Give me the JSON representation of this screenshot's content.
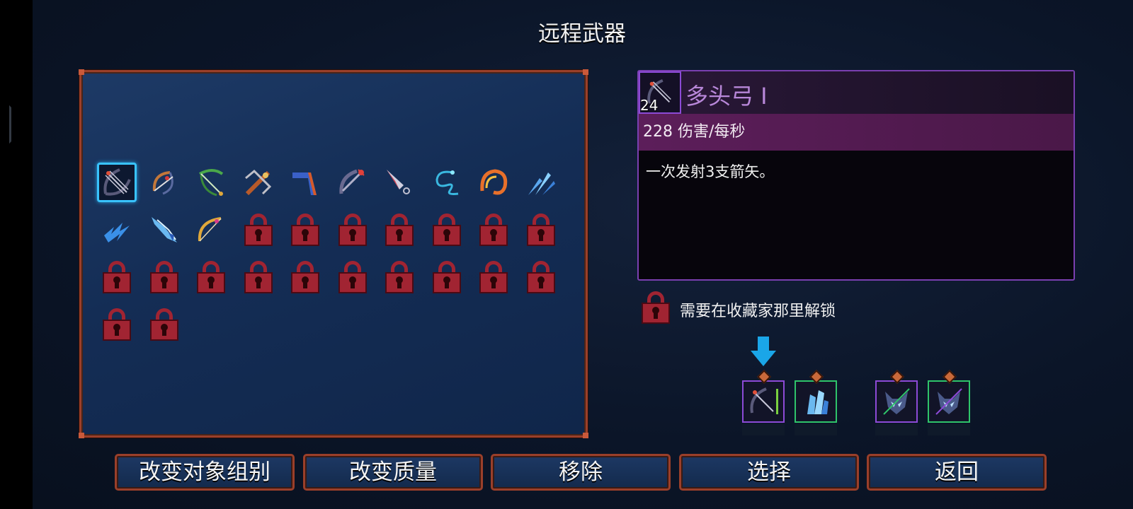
{
  "page": {
    "title": "远程武器"
  },
  "grid": {
    "weapons": [
      {
        "name": "multiple-nocks-bow-icon",
        "selected": true
      },
      {
        "name": "bow-icon"
      },
      {
        "name": "green-bow-icon"
      },
      {
        "name": "crossbow-icon"
      },
      {
        "name": "boomerang-icon"
      },
      {
        "name": "heavy-crossbow-icon"
      },
      {
        "name": "throwing-knife-icon"
      },
      {
        "name": "electric-whip-icon"
      },
      {
        "name": "fire-blast-icon"
      },
      {
        "name": "ice-shards-icon"
      },
      {
        "name": "lightning-icon"
      },
      {
        "name": "ice-crystal-icon"
      },
      {
        "name": "golden-bow-icon"
      }
    ],
    "locked_count": 19
  },
  "info": {
    "level": "24",
    "name": "多头弓 I",
    "stat": "228 伤害/每秒",
    "description": "一次发射3支箭矢。",
    "rarity_color": "#8c4ad6"
  },
  "unlock": {
    "text": "需要在收藏家那里解锁"
  },
  "equipment": [
    {
      "name": "equipped-bow-icon",
      "border": "purple"
    },
    {
      "name": "equipped-ice-icon",
      "border": "green"
    },
    {
      "name": "equipped-wolf-trap-icon-1",
      "border": "purple-green"
    },
    {
      "name": "equipped-wolf-trap-icon-2",
      "border": "purple-green"
    }
  ],
  "buttons": {
    "change_group": "改变对象组别",
    "change_quality": "改变质量",
    "remove": "移除",
    "select": "选择",
    "back": "返回"
  },
  "colors": {
    "panel_border": "#9a3f2a",
    "selection": "#39c3ff",
    "lock": "#a12432",
    "info_border": "#7a3fb0"
  }
}
